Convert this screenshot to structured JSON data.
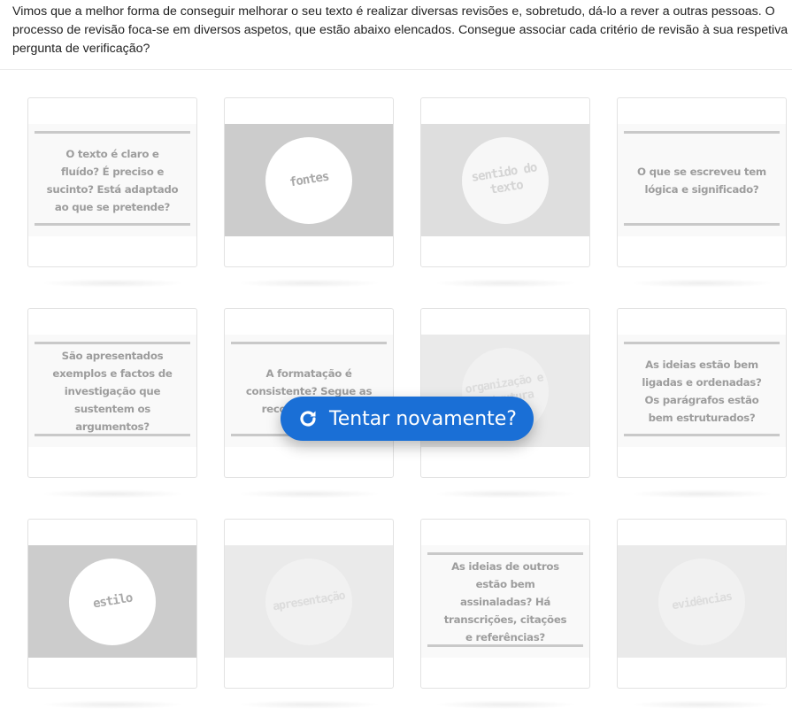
{
  "intro": "Vimos que a melhor forma de conseguir melhorar o seu texto é realizar diversas revisões e, sobretudo, dá-lo a rever a outras pessoas. O processo de revisão foca-se em diversos aspetos, que estão abaixo elencados. Consegue associar cada critério de revisão à sua respetiva pergunta de verificação?",
  "cards": [
    {
      "kind": "text",
      "text": "O texto é claro e fluído? É preciso e sucinto? Está adaptado ao que se pretende?"
    },
    {
      "kind": "word",
      "tone": "dark",
      "text": "fontes"
    },
    {
      "kind": "word",
      "tone": "mid",
      "text": "sentido do texto"
    },
    {
      "kind": "text",
      "text": "O que se escreveu tem lógica e  significado?"
    },
    {
      "kind": "text",
      "text": "São apresentados exemplos e factos de investigação que sustentem os argumentos?"
    },
    {
      "kind": "text",
      "text": "A formatação é consistente? Segue as recomendações?"
    },
    {
      "kind": "word",
      "tone": "light",
      "text": "organização e estrutura"
    },
    {
      "kind": "text",
      "text": "As ideias estão bem ligadas e ordenadas? Os parágrafos estão bem estruturados?"
    },
    {
      "kind": "word",
      "tone": "dark",
      "text": "estilo"
    },
    {
      "kind": "word",
      "tone": "light",
      "text": "apresentação",
      "small": true
    },
    {
      "kind": "text",
      "text": "As ideias de outros estão bem assinaladas? Há transcrições, citações e referências?"
    },
    {
      "kind": "word",
      "tone": "light",
      "text": "evidências"
    }
  ],
  "retry": {
    "label": "Tentar novamente?",
    "icon": "redo-icon",
    "color": "#1a6fd6"
  }
}
